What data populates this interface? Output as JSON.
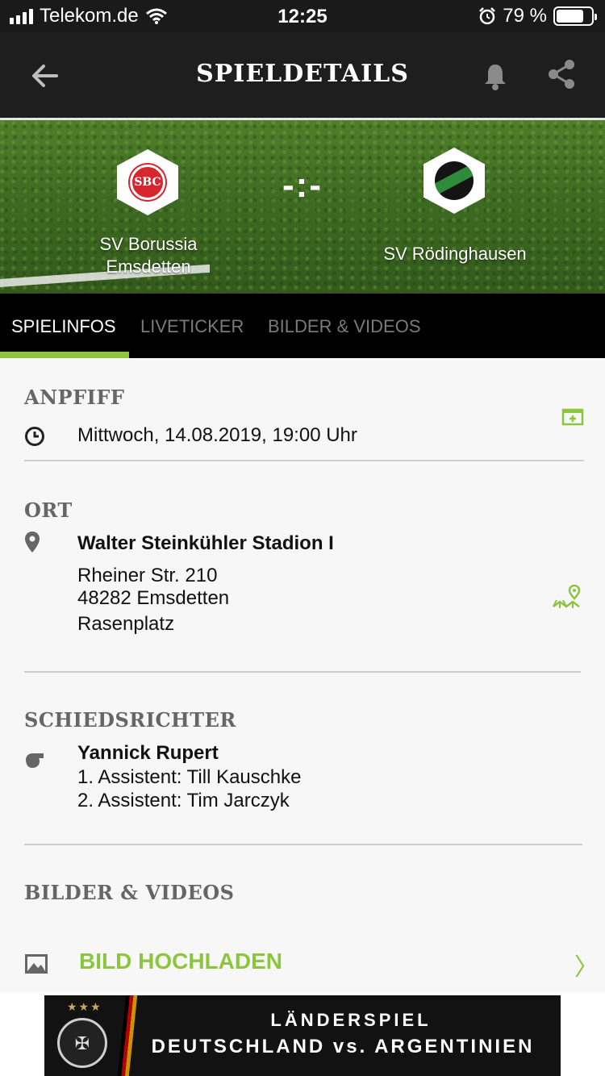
{
  "status": {
    "carrier": "Telekom.de",
    "time": "12:25",
    "battery": "79 %",
    "battery_level": 0.79
  },
  "header": {
    "title": "SPIELDETAILS"
  },
  "match": {
    "score": "-:-",
    "home": {
      "name": "SV Borussia Emsdetten",
      "crest_text": "SBC"
    },
    "away": {
      "name": "SV Rödinghausen"
    }
  },
  "tabs": [
    {
      "label": "SPIELINFOS",
      "active": true
    },
    {
      "label": "LIVETICKER",
      "active": false
    },
    {
      "label": "BILDER & VIDEOS",
      "active": false
    }
  ],
  "kickoff": {
    "title": "ANPFIFF",
    "datetime": "Mittwoch, 14.08.2019, 19:00 Uhr"
  },
  "location": {
    "title": "ORT",
    "stadium": "Walter Steinkühler Stadion I",
    "street": "Rheiner Str. 210",
    "city": "48282 Emsdetten",
    "surface": "Rasenplatz"
  },
  "referee": {
    "title": "SCHIEDSRICHTER",
    "name": "Yannick Rupert",
    "assistant1": "1. Assistent: Till Kauschke",
    "assistant2": "2. Assistent: Tim Jarczyk"
  },
  "media": {
    "title": "BILDER & VIDEOS",
    "upload_label": "BILD HOCHLADEN",
    "chevron": "〉"
  },
  "ad": {
    "line1": "LÄNDERSPIEL",
    "line2": "DEUTSCHLAND vs. ARGENTINIEN",
    "stars": "★★★",
    "crest_glyph": "✠"
  },
  "colors": {
    "accent": "#8cc63f",
    "header_bg": "#1e1e1e",
    "tab_bg": "#000000"
  }
}
